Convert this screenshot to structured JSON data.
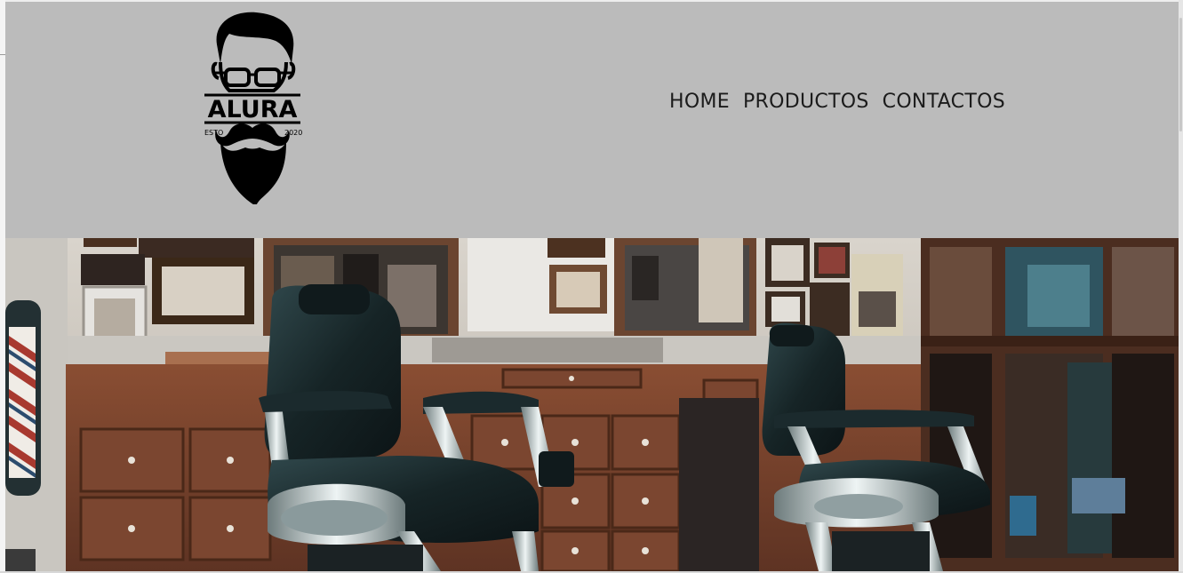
{
  "brand": {
    "name": "ALURA",
    "est_left": "ESTO",
    "est_right": "2020"
  },
  "nav": {
    "items": [
      {
        "label": "HOME"
      },
      {
        "label": "PRODUCTOS"
      },
      {
        "label": "CONTACTOS"
      }
    ]
  },
  "colors": {
    "header_bg": "#bbbbbb",
    "nav_text": "#1b1b1b",
    "logo": "#000000"
  },
  "hero": {
    "icons": [
      "barber-chair-icon",
      "barber-pole-icon"
    ]
  }
}
